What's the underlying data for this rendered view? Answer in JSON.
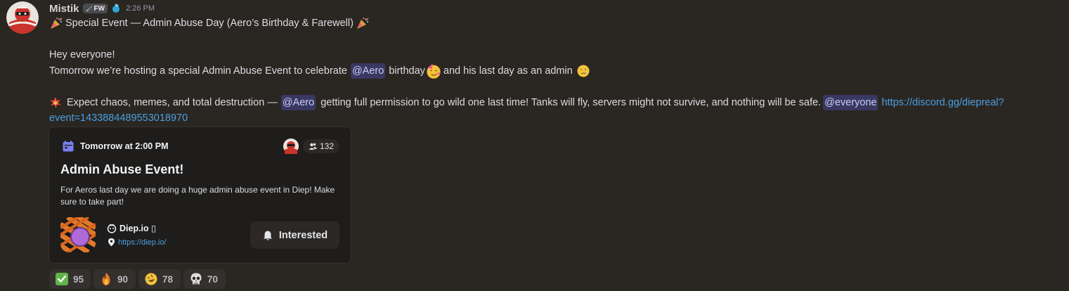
{
  "message": {
    "author": "Mistik",
    "tag_label": "FW",
    "timestamp": "2:26 PM",
    "line1": "Special Event — Admin Abuse Day (Aero’s Birthday & Farewell)",
    "line2": "Hey everyone!",
    "line3_a": "Tomorrow we’re hosting a special Admin Abuse Event to celebrate",
    "mention_aero": "@Aero",
    "line3_b": "birthday",
    "line3_c": "and his last day as an admin",
    "line4_a": "Expect chaos, memes, and total destruction —",
    "line4_b": "getting full permission to go wild one last time! Tanks will fly, servers might not survive, and nothing will be safe.",
    "mention_everyone": "@everyone",
    "link_part1": "https://discord.gg/diepreal?",
    "link_part2": "event=1433884489553018970"
  },
  "event_card": {
    "date": "Tomorrow at 2:00 PM",
    "interested_count": "132",
    "title": "Admin Abuse Event!",
    "description": "For Aeros last day we are doing a huge admin abuse event in Diep! Make sure to take part!",
    "guild_name": "Diep.io ▯",
    "location": "https://diep.io/",
    "interested_label": "Interested"
  },
  "reactions": [
    {
      "icon": "check-mark-emoji",
      "count": "95"
    },
    {
      "icon": "fire-emoji",
      "count": "90"
    },
    {
      "icon": "rofl-emoji",
      "count": "78"
    },
    {
      "icon": "skull-emoji",
      "count": "70"
    }
  ],
  "colors": {
    "background": "#2a2622",
    "link": "#4a9fe0",
    "mention_bg": "rgba(88,101,242,0.3)",
    "calendar_icon": "#7a7ff0"
  }
}
